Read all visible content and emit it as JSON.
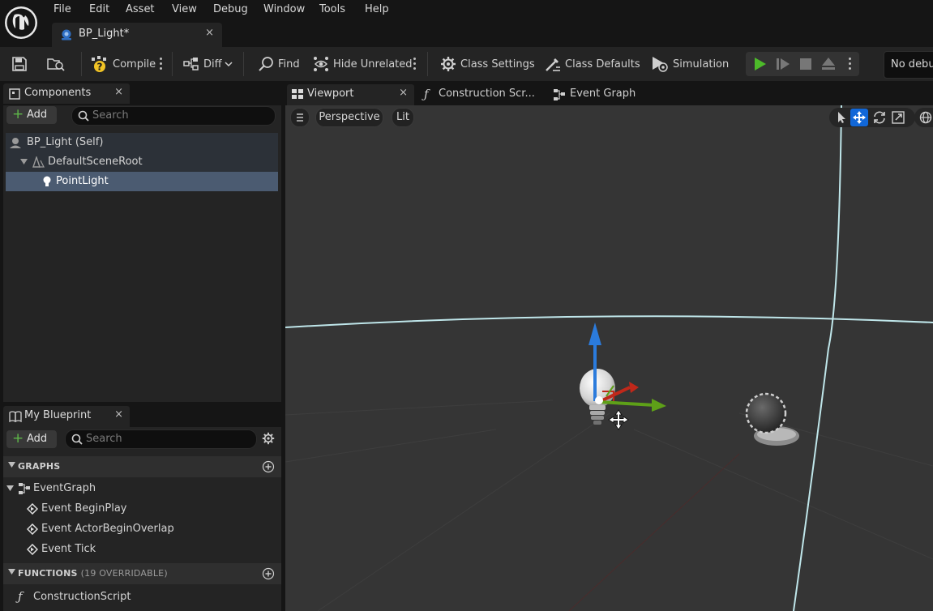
{
  "menu": {
    "items": [
      "File",
      "Edit",
      "Asset",
      "View",
      "Debug",
      "Window",
      "Tools",
      "Help"
    ],
    "logo_icon": "unreal-engine-logo"
  },
  "asset_tab": {
    "label": "BP_Light*",
    "close": "×",
    "icon": "blueprint-icon"
  },
  "toolbar": {
    "compile": "Compile",
    "diff": "Diff",
    "find": "Find",
    "hide_unrelated": "Hide Unrelated",
    "class_settings": "Class Settings",
    "class_defaults": "Class Defaults",
    "simulation": "Simulation",
    "debug_filter": "No debug",
    "icons": [
      "save-icon",
      "browse-icon",
      "compile-warning-icon",
      "diff-icon",
      "find-icon",
      "hide-unrelated-icon",
      "gear-icon",
      "class-defaults-icon",
      "simulation-icon",
      "play-icon",
      "advance-frame-icon",
      "stop-icon",
      "eject-icon"
    ]
  },
  "components": {
    "tab_label": "Components",
    "close": "×",
    "add_label": "Add",
    "search_placeholder": "Search",
    "tree": [
      {
        "label": "BP_Light (Self)",
        "icon": "actor-self-icon"
      },
      {
        "label": "DefaultSceneRoot",
        "icon": "scene-root-icon"
      },
      {
        "label": "PointLight",
        "icon": "light-bulb-icon",
        "selected": true
      }
    ]
  },
  "my_blueprint": {
    "tab_label": "My Blueprint",
    "close": "×",
    "add_label": "Add",
    "search_placeholder": "Search",
    "graphs_header": "GRAPHS",
    "event_graph": "EventGraph",
    "events": [
      "Event BeginPlay",
      "Event ActorBeginOverlap",
      "Event Tick"
    ],
    "functions_header": "FUNCTIONS",
    "functions_sub": "(19 OVERRIDABLE)",
    "construction_script": "ConstructionScript"
  },
  "editor_tabs": [
    {
      "label": "Viewport",
      "icon": "viewport-grid-icon",
      "active": true,
      "close": "×"
    },
    {
      "label": "Construction Scr...",
      "icon": "function-icon",
      "active": false
    },
    {
      "label": "Event Graph",
      "icon": "event-graph-icon",
      "active": false
    }
  ],
  "viewport": {
    "view_mode": "Perspective",
    "lighting_mode": "Lit",
    "active_tool": "translate",
    "colors": {
      "background": "#353535",
      "gizmo_x": "#c0281a",
      "gizmo_y": "#5ea018",
      "gizmo_z": "#2b7bdc",
      "selected_tool": "#1167d8"
    }
  },
  "colors": {
    "accent_blue": "#2f6fc4",
    "play_green": "#4dbb2a",
    "selection_row": "#4b5b71"
  }
}
